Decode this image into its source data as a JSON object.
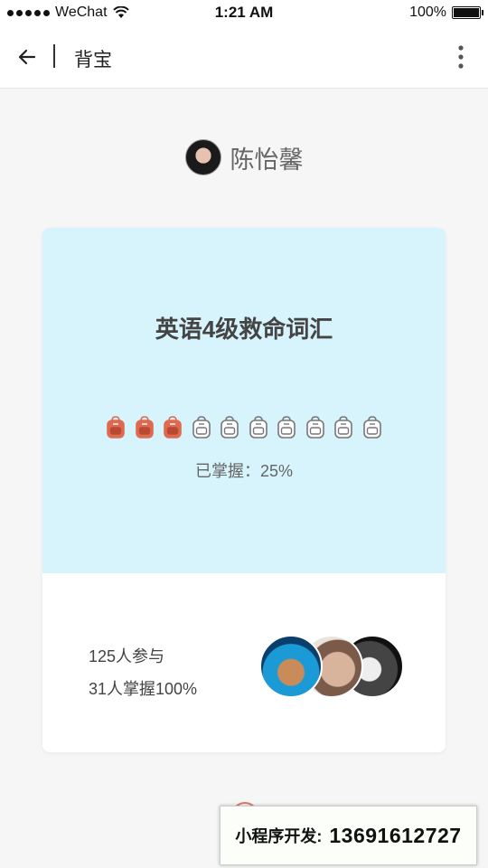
{
  "status_bar": {
    "carrier": "WeChat",
    "time": "1:21 AM",
    "battery": "100%",
    "battery_level": 1.0
  },
  "nav": {
    "title": "背宝",
    "back_icon": "arrow-left-icon",
    "more_icon": "more-vertical-icon"
  },
  "user": {
    "name": "陈怡馨"
  },
  "card": {
    "title": "英语4级救命词汇",
    "progress_text": "已掌握：25%",
    "progress_fraction": 0.25,
    "bag_icons_total": 10,
    "bag_icons_filled": 3,
    "accent_color": "#e06a4f",
    "card_top_color": "#d7f3fb",
    "participants": "125人参与",
    "mastered": "31人掌握100%"
  },
  "watermark": {
    "label": "小程序开发:",
    "phone": "13691612727"
  }
}
